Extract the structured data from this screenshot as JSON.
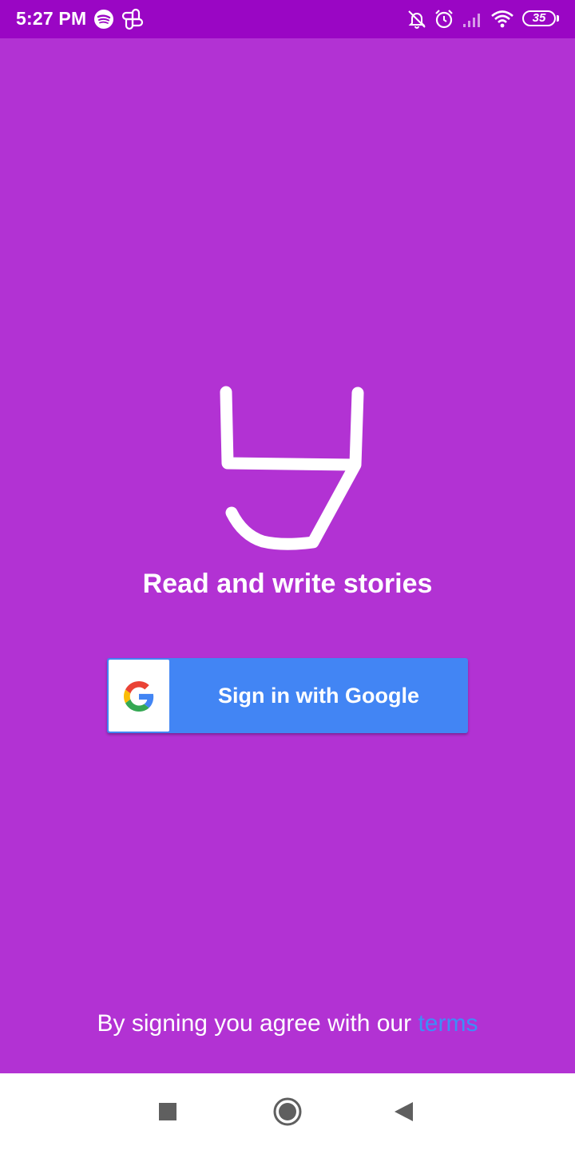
{
  "status_bar": {
    "time": "5:27 PM",
    "battery_level": "35",
    "icons": [
      "spotify-icon",
      "pinwheel-icon",
      "mute-bell-icon",
      "alarm-icon",
      "signal-icon",
      "wifi-icon",
      "battery-icon"
    ]
  },
  "app": {
    "tagline": "Read and write stories",
    "logo_icon": "app-logo-icon"
  },
  "sign_in": {
    "label": "Sign in with Google",
    "icon": "google-g-icon"
  },
  "terms": {
    "prefix": "By signing you agree with our ",
    "link_label": "terms"
  },
  "nav_bar": {
    "items": [
      "recents-square-icon",
      "home-circle-icon",
      "back-triangle-icon"
    ]
  },
  "colors": {
    "background": "#b232d3",
    "status_bar": "#9a06c4",
    "google_button": "#4285f4",
    "terms_link": "#3d8ef8"
  }
}
